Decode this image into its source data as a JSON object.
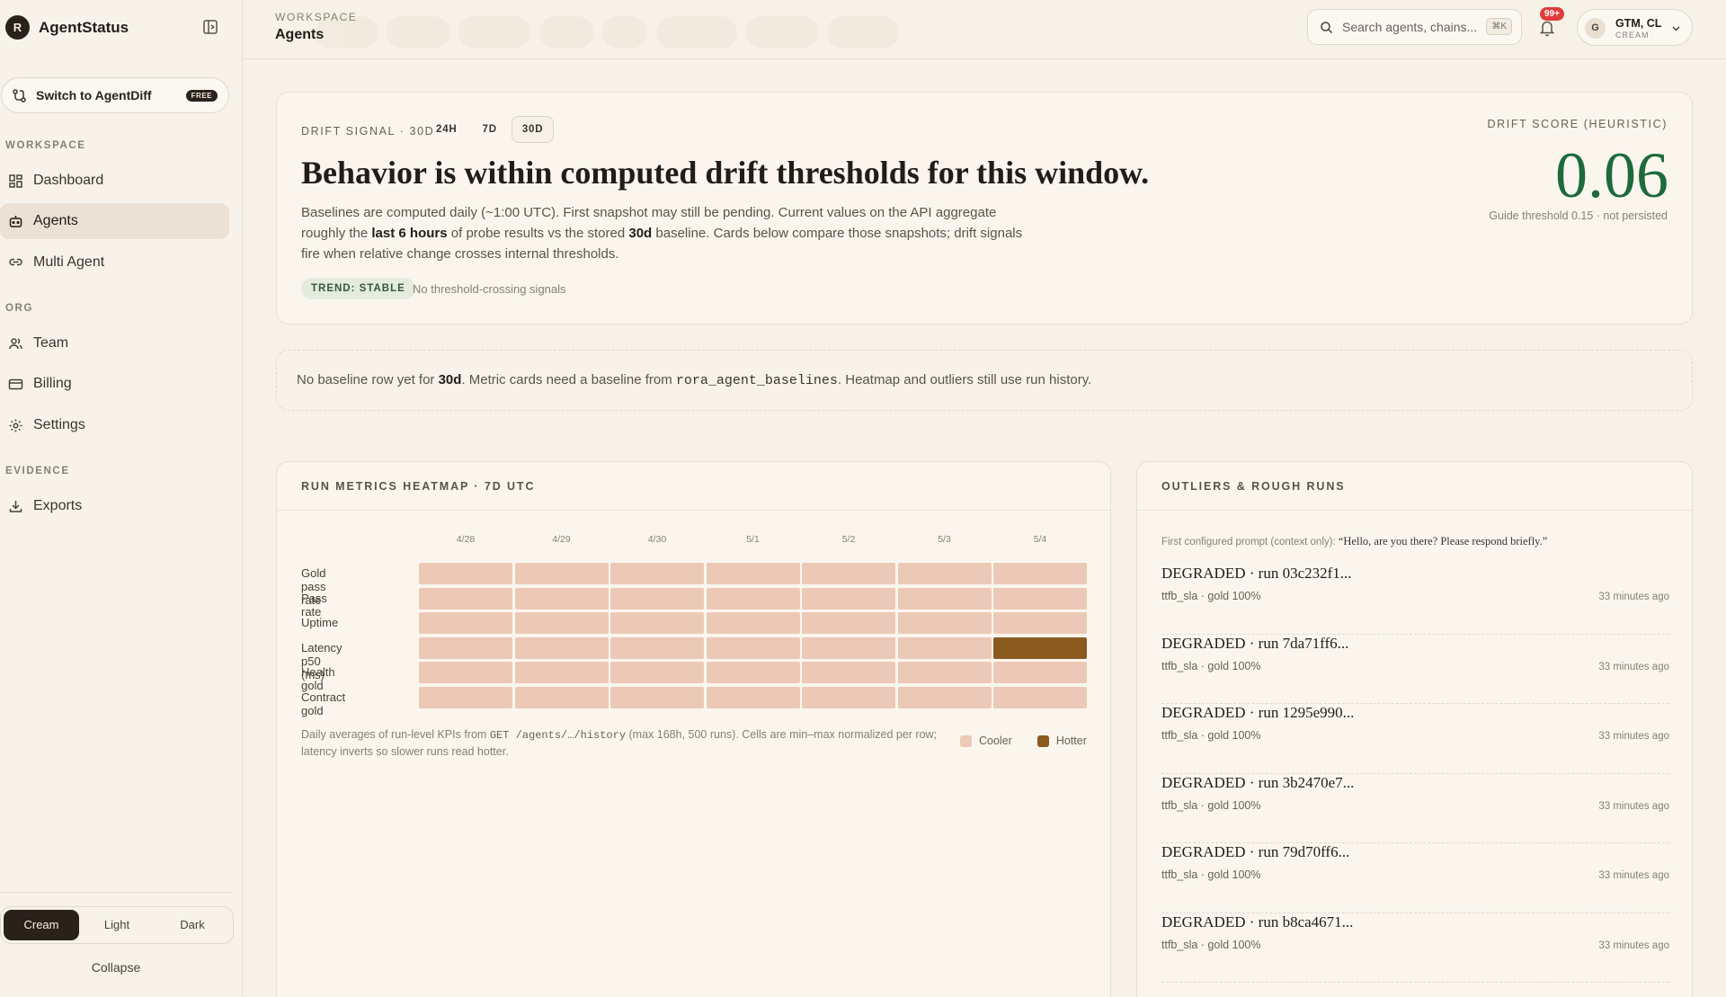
{
  "app": {
    "logo_letter": "R",
    "name": "AgentStatus"
  },
  "sidebar": {
    "switch_label": "Switch to AgentDiff",
    "switch_badge": "FREE",
    "sections": {
      "workspace": "WORKSPACE",
      "org": "ORG",
      "evidence": "EVIDENCE"
    },
    "items": {
      "dashboard": "Dashboard",
      "agents": "Agents",
      "multi_agent": "Multi Agent",
      "team": "Team",
      "billing": "Billing",
      "settings": "Settings",
      "exports": "Exports"
    },
    "active_item": "Agents",
    "themes": [
      "Cream",
      "Light",
      "Dark"
    ],
    "active_theme": "Cream",
    "collapse_label": "Collapse"
  },
  "topbar": {
    "crumb_small": "WORKSPACE",
    "crumb_title": "Agents",
    "search_placeholder": "Search agents, chains...",
    "search_shortcut": "⌘K",
    "notif_count": "99+",
    "account_initial": "G",
    "account_name": "GTM, CL",
    "account_theme": "CREAM"
  },
  "drift": {
    "label": "DRIFT SIGNAL · 30D",
    "ranges": [
      "24H",
      "7D",
      "30D"
    ],
    "active_range": "30D",
    "headline": "Behavior is within computed drift thresholds for this window.",
    "desc_1": "Baselines are computed daily (~1:00 UTC). First snapshot may still be pending. Current values on the API aggregate roughly the ",
    "desc_bold_1": "last 6 hours",
    "desc_2": " of probe results vs the stored ",
    "desc_bold_2": "30d",
    "desc_3": " baseline. Cards below compare those snapshots; drift signals fire when relative change crosses internal thresholds.",
    "trend": "TREND: STABLE",
    "trend_note": "No threshold-crossing signals",
    "score_label": "DRIFT SCORE (HEURISTIC)",
    "score_value": "0.06",
    "score_note": "Guide threshold 0.15 · not persisted",
    "score_color": "#1d6a3c"
  },
  "baseline": {
    "t1": "No baseline row yet for ",
    "b1": "30d",
    "t2": ". Metric cards need a baseline from ",
    "code": "rora_agent_baselines",
    "t3": ". Heatmap and outliers still use run history."
  },
  "heatmap": {
    "title": "RUN METRICS HEATMAP · 7D UTC",
    "columns": [
      "4/28",
      "4/29",
      "4/30",
      "5/1",
      "5/2",
      "5/3",
      "5/4"
    ],
    "rows": [
      "Gold pass rate",
      "Pass rate",
      "Uptime",
      "Latency p50 (ms)",
      "Health gold",
      "Contract gold"
    ],
    "hot_cells": [
      [
        3,
        6
      ]
    ],
    "note_1": "Daily averages of run-level KPIs from ",
    "note_code": "GET /agents/…/history",
    "note_2": " (max 168h, 500 runs). Cells are min–max normalized per row; latency inverts so slower runs read hotter.",
    "legend_cool": "Cooler",
    "legend_hot": "Hotter",
    "cool_color": "#ecc9b6",
    "hot_color": "#8a5a1f"
  },
  "outliers": {
    "title": "OUTLIERS & ROUGH RUNS",
    "context_label": "First configured prompt (context only): ",
    "context_prompt": "“Hello, are you there? Please respond briefly.”",
    "items": [
      {
        "title": "DEGRADED · run 03c232f1...",
        "sub": "ttfb_sla · gold 100%",
        "time": "33 minutes ago"
      },
      {
        "title": "DEGRADED · run 7da71ff6...",
        "sub": "ttfb_sla · gold 100%",
        "time": "33 minutes ago"
      },
      {
        "title": "DEGRADED · run 1295e990...",
        "sub": "ttfb_sla · gold 100%",
        "time": "33 minutes ago"
      },
      {
        "title": "DEGRADED · run 3b2470e7...",
        "sub": "ttfb_sla · gold 100%",
        "time": "33 minutes ago"
      },
      {
        "title": "DEGRADED · run 79d70ff6...",
        "sub": "ttfb_sla · gold 100%",
        "time": "33 minutes ago"
      },
      {
        "title": "DEGRADED · run b8ca4671...",
        "sub": "ttfb_sla · gold 100%",
        "time": "33 minutes ago"
      }
    ]
  }
}
